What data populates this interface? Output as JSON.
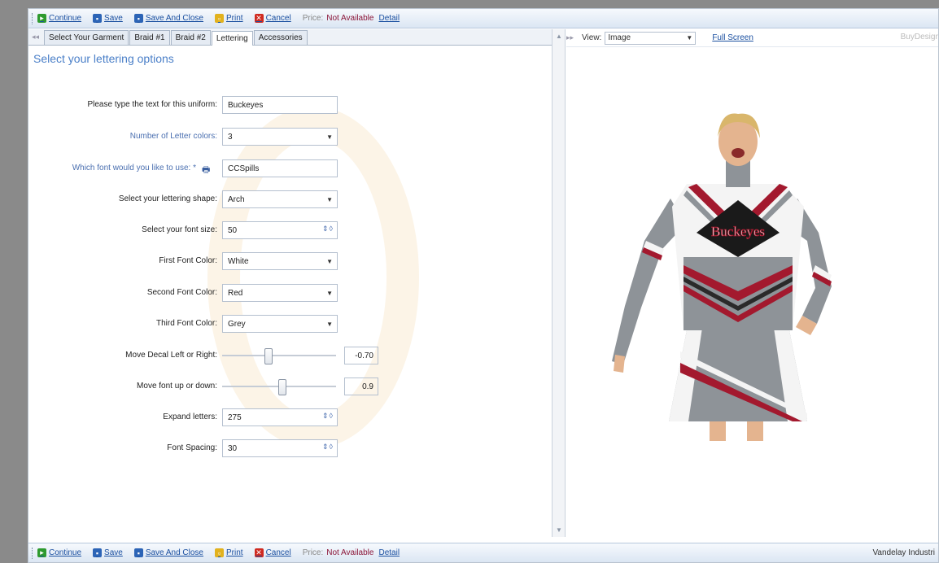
{
  "toolbar": {
    "continue_label": "Continue",
    "save_label": "Save",
    "save_close_label": "Save And Close",
    "print_label": "Print",
    "cancel_label": "Cancel",
    "price_label": "Price:",
    "price_value": "Not Available",
    "detail_label": "Detail"
  },
  "bottom_bar": {
    "vendor": "Vandelay Industri"
  },
  "tabs": [
    {
      "label": "Select Your Garment"
    },
    {
      "label": "Braid #1"
    },
    {
      "label": "Braid #2"
    },
    {
      "label": "Lettering"
    },
    {
      "label": "Accessories"
    }
  ],
  "active_tab": "Lettering",
  "section_title": "Select your lettering options",
  "form": {
    "text_label": "Please type the text for this uniform:",
    "text_value": "Buckeyes",
    "letter_colors_label": "Number of Letter colors:",
    "letter_colors_value": "3",
    "font_label": "Which font would you like to use: *",
    "font_value": "CCSpills",
    "shape_label": "Select your lettering shape:",
    "shape_value": "Arch",
    "font_size_label": "Select your font size:",
    "font_size_value": "50",
    "first_color_label": "First Font Color:",
    "first_color_value": "White",
    "second_color_label": "Second Font Color:",
    "second_color_value": "Red",
    "third_color_label": "Third Font Color:",
    "third_color_value": "Grey",
    "move_lr_label": "Move Decal Left or Right:",
    "move_lr_value": "-0.70",
    "move_lr_fraction": 0.4,
    "move_ud_label": "Move font up or down:",
    "move_ud_value": "0.9",
    "move_ud_fraction": 0.53,
    "expand_label": "Expand letters:",
    "expand_value": "275",
    "spacing_label": "Font Spacing:",
    "spacing_value": "30"
  },
  "preview": {
    "view_label": "View:",
    "view_value": "Image",
    "fullscreen_label": "Full Screen",
    "brand": "BuyDesign",
    "uniform_text": "Buckeyes"
  },
  "colors": {
    "uniform_grey": "#8e9398",
    "uniform_red": "#a3192e",
    "uniform_white": "#f4f4f4",
    "link_blue": "#1a4fa0"
  }
}
